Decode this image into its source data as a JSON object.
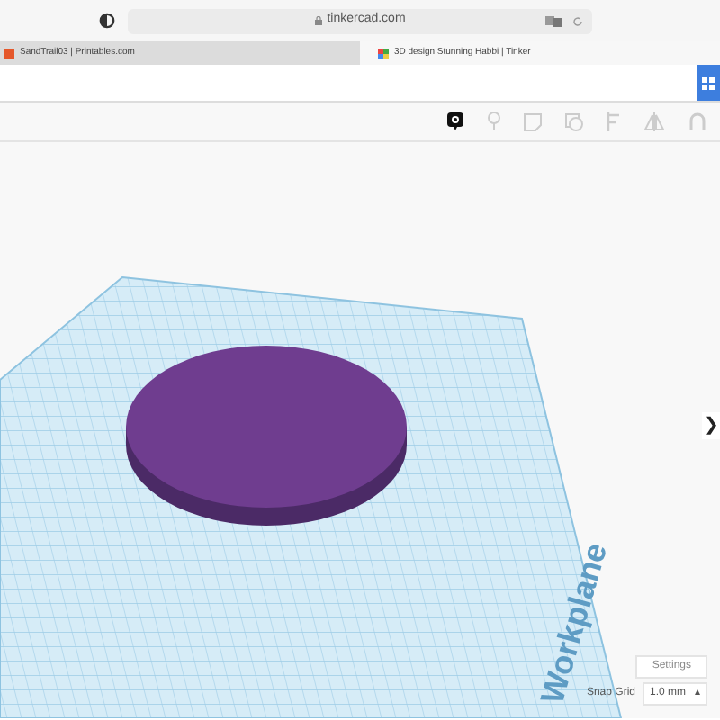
{
  "browser": {
    "address": "tinkercad.com"
  },
  "tabs": [
    {
      "label": "SandTrail03 | Printables.com",
      "selected": false
    },
    {
      "label": "3D design Stunning Habbi | Tinker",
      "selected": true
    }
  ],
  "workplane": {
    "label": "Workplane"
  },
  "settings_button": "Settings",
  "snap_grid": {
    "label": "Snap Grid",
    "value": "1.0 mm",
    "arrow": "▴"
  },
  "side_toggle": "❯"
}
